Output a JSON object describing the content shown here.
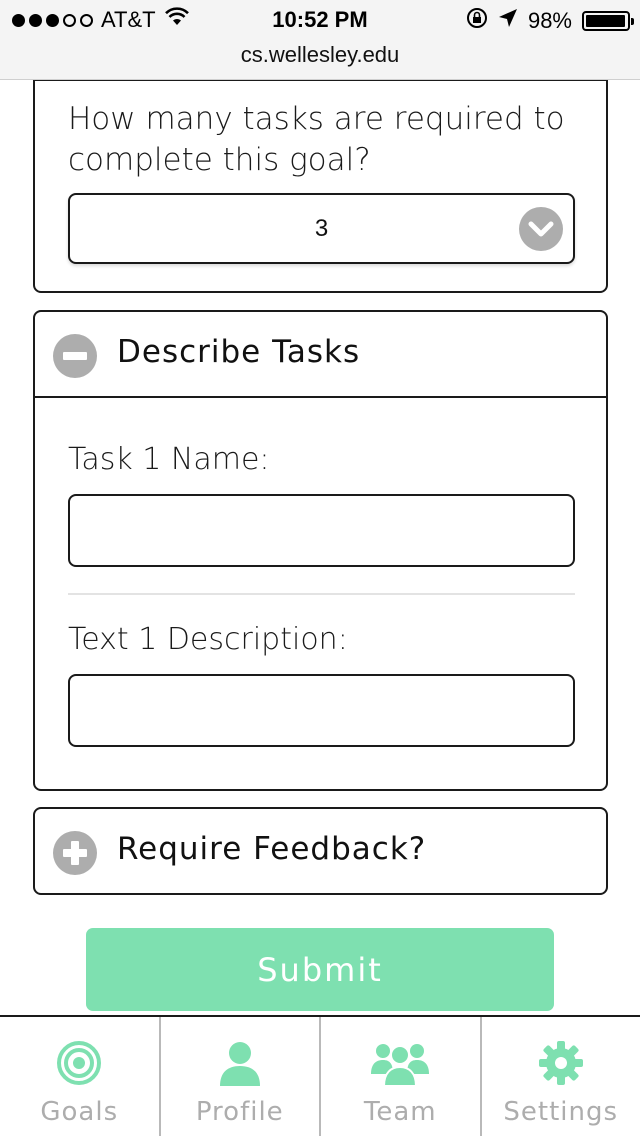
{
  "status_bar": {
    "carrier": "AT&T",
    "signal_bars_filled": 3,
    "signal_bars_total": 5,
    "time": "10:52 PM",
    "battery": "98%",
    "battery_level": 0.98,
    "url": "cs.wellesley.edu"
  },
  "task_count": {
    "question": "How many tasks are required to complete this goal?",
    "selected": "3"
  },
  "describe_tasks": {
    "title": "Describe Tasks",
    "task_name_label": "Task 1 Name:",
    "task_name_value": "",
    "description_label": "Text 1 Description:",
    "description_value": ""
  },
  "require_feedback": {
    "title": "Require Feedback?"
  },
  "submit_label": "Submit",
  "tabs": [
    {
      "label": "Goals",
      "icon": "target-icon"
    },
    {
      "label": "Profile",
      "icon": "person-icon"
    },
    {
      "label": "Team",
      "icon": "group-icon"
    },
    {
      "label": "Settings",
      "icon": "gear-icon"
    }
  ],
  "colors": {
    "accent": "#7ee0b0",
    "icon_gray": "#adadad",
    "border": "#1a1a1a"
  }
}
